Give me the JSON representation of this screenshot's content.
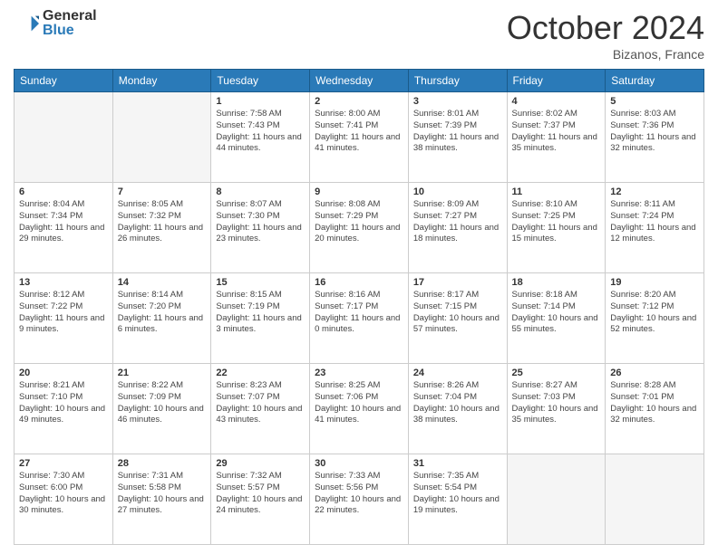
{
  "header": {
    "logo_general": "General",
    "logo_blue": "Blue",
    "month_title": "October 2024",
    "subtitle": "Bizanos, France"
  },
  "weekdays": [
    "Sunday",
    "Monday",
    "Tuesday",
    "Wednesday",
    "Thursday",
    "Friday",
    "Saturday"
  ],
  "weeks": [
    [
      {
        "day": "",
        "sunrise": "",
        "sunset": "",
        "daylight": "",
        "empty": true
      },
      {
        "day": "",
        "sunrise": "",
        "sunset": "",
        "daylight": "",
        "empty": true
      },
      {
        "day": "1",
        "sunrise": "Sunrise: 7:58 AM",
        "sunset": "Sunset: 7:43 PM",
        "daylight": "Daylight: 11 hours and 44 minutes."
      },
      {
        "day": "2",
        "sunrise": "Sunrise: 8:00 AM",
        "sunset": "Sunset: 7:41 PM",
        "daylight": "Daylight: 11 hours and 41 minutes."
      },
      {
        "day": "3",
        "sunrise": "Sunrise: 8:01 AM",
        "sunset": "Sunset: 7:39 PM",
        "daylight": "Daylight: 11 hours and 38 minutes."
      },
      {
        "day": "4",
        "sunrise": "Sunrise: 8:02 AM",
        "sunset": "Sunset: 7:37 PM",
        "daylight": "Daylight: 11 hours and 35 minutes."
      },
      {
        "day": "5",
        "sunrise": "Sunrise: 8:03 AM",
        "sunset": "Sunset: 7:36 PM",
        "daylight": "Daylight: 11 hours and 32 minutes."
      }
    ],
    [
      {
        "day": "6",
        "sunrise": "Sunrise: 8:04 AM",
        "sunset": "Sunset: 7:34 PM",
        "daylight": "Daylight: 11 hours and 29 minutes."
      },
      {
        "day": "7",
        "sunrise": "Sunrise: 8:05 AM",
        "sunset": "Sunset: 7:32 PM",
        "daylight": "Daylight: 11 hours and 26 minutes."
      },
      {
        "day": "8",
        "sunrise": "Sunrise: 8:07 AM",
        "sunset": "Sunset: 7:30 PM",
        "daylight": "Daylight: 11 hours and 23 minutes."
      },
      {
        "day": "9",
        "sunrise": "Sunrise: 8:08 AM",
        "sunset": "Sunset: 7:29 PM",
        "daylight": "Daylight: 11 hours and 20 minutes."
      },
      {
        "day": "10",
        "sunrise": "Sunrise: 8:09 AM",
        "sunset": "Sunset: 7:27 PM",
        "daylight": "Daylight: 11 hours and 18 minutes."
      },
      {
        "day": "11",
        "sunrise": "Sunrise: 8:10 AM",
        "sunset": "Sunset: 7:25 PM",
        "daylight": "Daylight: 11 hours and 15 minutes."
      },
      {
        "day": "12",
        "sunrise": "Sunrise: 8:11 AM",
        "sunset": "Sunset: 7:24 PM",
        "daylight": "Daylight: 11 hours and 12 minutes."
      }
    ],
    [
      {
        "day": "13",
        "sunrise": "Sunrise: 8:12 AM",
        "sunset": "Sunset: 7:22 PM",
        "daylight": "Daylight: 11 hours and 9 minutes."
      },
      {
        "day": "14",
        "sunrise": "Sunrise: 8:14 AM",
        "sunset": "Sunset: 7:20 PM",
        "daylight": "Daylight: 11 hours and 6 minutes."
      },
      {
        "day": "15",
        "sunrise": "Sunrise: 8:15 AM",
        "sunset": "Sunset: 7:19 PM",
        "daylight": "Daylight: 11 hours and 3 minutes."
      },
      {
        "day": "16",
        "sunrise": "Sunrise: 8:16 AM",
        "sunset": "Sunset: 7:17 PM",
        "daylight": "Daylight: 11 hours and 0 minutes."
      },
      {
        "day": "17",
        "sunrise": "Sunrise: 8:17 AM",
        "sunset": "Sunset: 7:15 PM",
        "daylight": "Daylight: 10 hours and 57 minutes."
      },
      {
        "day": "18",
        "sunrise": "Sunrise: 8:18 AM",
        "sunset": "Sunset: 7:14 PM",
        "daylight": "Daylight: 10 hours and 55 minutes."
      },
      {
        "day": "19",
        "sunrise": "Sunrise: 8:20 AM",
        "sunset": "Sunset: 7:12 PM",
        "daylight": "Daylight: 10 hours and 52 minutes."
      }
    ],
    [
      {
        "day": "20",
        "sunrise": "Sunrise: 8:21 AM",
        "sunset": "Sunset: 7:10 PM",
        "daylight": "Daylight: 10 hours and 49 minutes."
      },
      {
        "day": "21",
        "sunrise": "Sunrise: 8:22 AM",
        "sunset": "Sunset: 7:09 PM",
        "daylight": "Daylight: 10 hours and 46 minutes."
      },
      {
        "day": "22",
        "sunrise": "Sunrise: 8:23 AM",
        "sunset": "Sunset: 7:07 PM",
        "daylight": "Daylight: 10 hours and 43 minutes."
      },
      {
        "day": "23",
        "sunrise": "Sunrise: 8:25 AM",
        "sunset": "Sunset: 7:06 PM",
        "daylight": "Daylight: 10 hours and 41 minutes."
      },
      {
        "day": "24",
        "sunrise": "Sunrise: 8:26 AM",
        "sunset": "Sunset: 7:04 PM",
        "daylight": "Daylight: 10 hours and 38 minutes."
      },
      {
        "day": "25",
        "sunrise": "Sunrise: 8:27 AM",
        "sunset": "Sunset: 7:03 PM",
        "daylight": "Daylight: 10 hours and 35 minutes."
      },
      {
        "day": "26",
        "sunrise": "Sunrise: 8:28 AM",
        "sunset": "Sunset: 7:01 PM",
        "daylight": "Daylight: 10 hours and 32 minutes."
      }
    ],
    [
      {
        "day": "27",
        "sunrise": "Sunrise: 7:30 AM",
        "sunset": "Sunset: 6:00 PM",
        "daylight": "Daylight: 10 hours and 30 minutes."
      },
      {
        "day": "28",
        "sunrise": "Sunrise: 7:31 AM",
        "sunset": "Sunset: 5:58 PM",
        "daylight": "Daylight: 10 hours and 27 minutes."
      },
      {
        "day": "29",
        "sunrise": "Sunrise: 7:32 AM",
        "sunset": "Sunset: 5:57 PM",
        "daylight": "Daylight: 10 hours and 24 minutes."
      },
      {
        "day": "30",
        "sunrise": "Sunrise: 7:33 AM",
        "sunset": "Sunset: 5:56 PM",
        "daylight": "Daylight: 10 hours and 22 minutes."
      },
      {
        "day": "31",
        "sunrise": "Sunrise: 7:35 AM",
        "sunset": "Sunset: 5:54 PM",
        "daylight": "Daylight: 10 hours and 19 minutes."
      },
      {
        "day": "",
        "sunrise": "",
        "sunset": "",
        "daylight": "",
        "empty": true
      },
      {
        "day": "",
        "sunrise": "",
        "sunset": "",
        "daylight": "",
        "empty": true
      }
    ]
  ]
}
